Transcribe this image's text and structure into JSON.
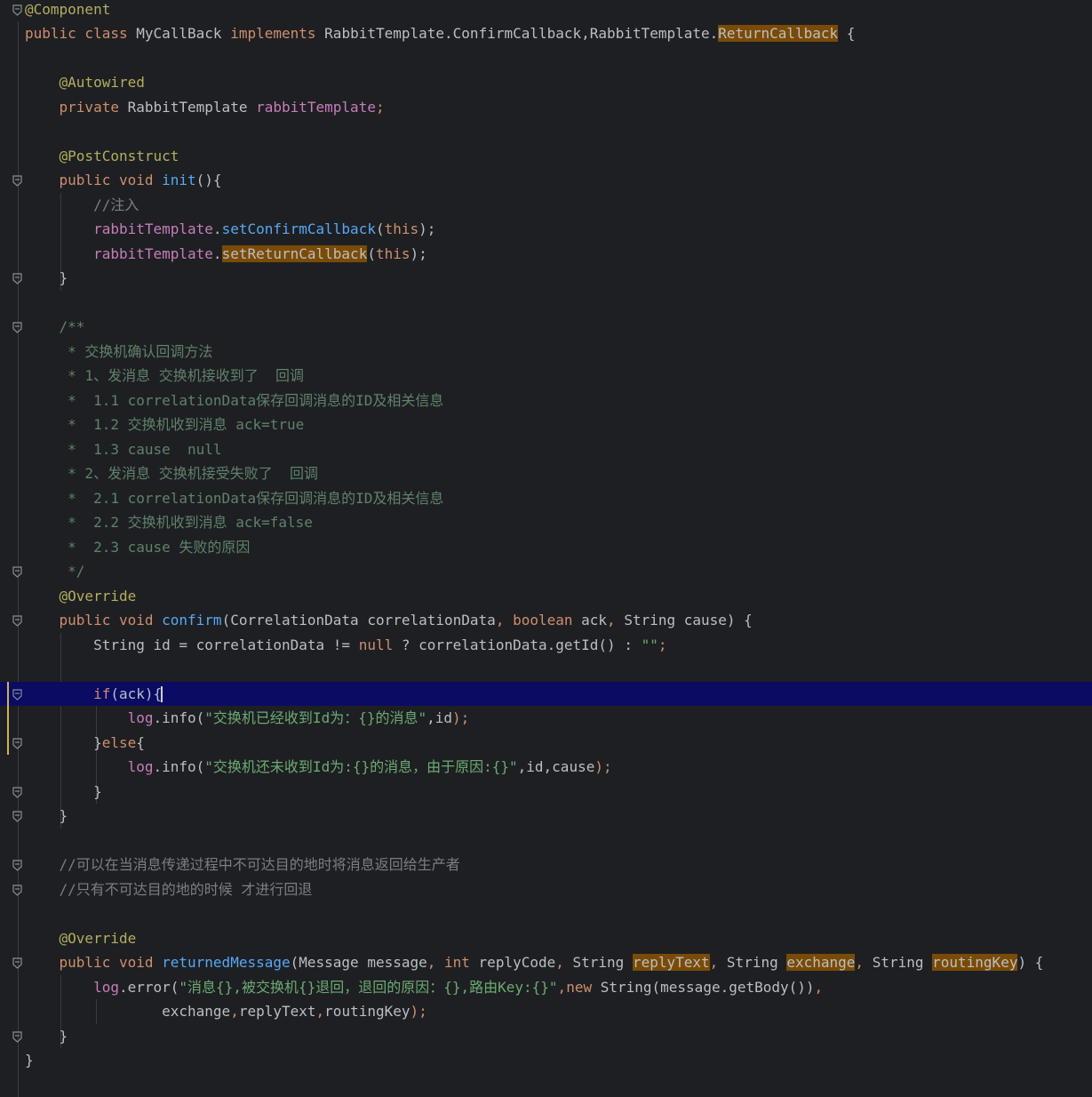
{
  "colors": {
    "background": "#1e1f22",
    "current_line": "#0b0b64",
    "keyword": "#cf8e6d",
    "annotation": "#b3ae60",
    "field": "#c77dbb",
    "method_decl": "#56a8f5",
    "comment": "#7a7e85",
    "doc_comment": "#5f826b",
    "string": "#6aab73",
    "default": "#bcbec4",
    "highlight": "#7a4b06"
  },
  "editor": {
    "lines": [
      {
        "fold": true,
        "tokens": [
          {
            "t": "@Component",
            "c": "annotation"
          }
        ]
      },
      {
        "tokens": [
          {
            "t": "public class ",
            "c": "keyword"
          },
          {
            "t": "MyCallBack ",
            "c": "default"
          },
          {
            "t": "implements ",
            "c": "keyword"
          },
          {
            "t": "RabbitTemplate.ConfirmCallback,RabbitTemplate.",
            "c": "default"
          },
          {
            "t": "ReturnCallback",
            "c": "highlight"
          },
          {
            "t": " {",
            "c": "default"
          }
        ]
      },
      {
        "tokens": []
      },
      {
        "tokens": [
          {
            "t": "    ",
            "c": "default"
          },
          {
            "t": "@Autowired",
            "c": "annotation"
          }
        ]
      },
      {
        "tokens": [
          {
            "t": "    ",
            "c": "default"
          },
          {
            "t": "private ",
            "c": "keyword"
          },
          {
            "t": "RabbitTemplate ",
            "c": "default"
          },
          {
            "t": "rabbitTemplate",
            "c": "field"
          },
          {
            "t": ";",
            "c": "keyword"
          }
        ]
      },
      {
        "tokens": []
      },
      {
        "tokens": [
          {
            "t": "    ",
            "c": "default"
          },
          {
            "t": "@PostConstruct",
            "c": "annotation"
          }
        ]
      },
      {
        "fold": true,
        "tokens": [
          {
            "t": "    ",
            "c": "default"
          },
          {
            "t": "public void ",
            "c": "keyword"
          },
          {
            "t": "init",
            "c": "method_decl"
          },
          {
            "t": "(){",
            "c": "default"
          }
        ]
      },
      {
        "tokens": [
          {
            "t": "        ",
            "c": "default"
          },
          {
            "t": "//注入",
            "c": "comment"
          }
        ]
      },
      {
        "tokens": [
          {
            "t": "        ",
            "c": "default"
          },
          {
            "t": "rabbitTemplate",
            "c": "field"
          },
          {
            "t": ".",
            "c": "default"
          },
          {
            "t": "setConfirmCallback",
            "c": "method_decl"
          },
          {
            "t": "(",
            "c": "default"
          },
          {
            "t": "this",
            "c": "keyword"
          },
          {
            "t": ");",
            "c": "default"
          }
        ]
      },
      {
        "tokens": [
          {
            "t": "        ",
            "c": "default"
          },
          {
            "t": "rabbitTemplate",
            "c": "field"
          },
          {
            "t": ".",
            "c": "default"
          },
          {
            "t": "setReturnCallback",
            "c": "highlight"
          },
          {
            "t": "(",
            "c": "default"
          },
          {
            "t": "this",
            "c": "keyword"
          },
          {
            "t": ");",
            "c": "default"
          }
        ]
      },
      {
        "fold": true,
        "tokens": [
          {
            "t": "    }",
            "c": "default"
          }
        ]
      },
      {
        "tokens": []
      },
      {
        "fold": true,
        "tokens": [
          {
            "t": "    /**",
            "c": "doc_comment"
          }
        ]
      },
      {
        "tokens": [
          {
            "t": "     * 交换机确认回调方法",
            "c": "doc_comment"
          }
        ]
      },
      {
        "tokens": [
          {
            "t": "     * 1、发消息 交换机接收到了  回调",
            "c": "doc_comment"
          }
        ]
      },
      {
        "tokens": [
          {
            "t": "     *  1.1 correlationData保存回调消息的ID及相关信息",
            "c": "doc_comment"
          }
        ]
      },
      {
        "tokens": [
          {
            "t": "     *  1.2 交换机收到消息 ack=true",
            "c": "doc_comment"
          }
        ]
      },
      {
        "tokens": [
          {
            "t": "     *  1.3 cause  null",
            "c": "doc_comment"
          }
        ]
      },
      {
        "tokens": [
          {
            "t": "     * 2、发消息 交换机接受失败了  回调",
            "c": "doc_comment"
          }
        ]
      },
      {
        "tokens": [
          {
            "t": "     *  2.1 correlationData保存回调消息的ID及相关信息",
            "c": "doc_comment"
          }
        ]
      },
      {
        "tokens": [
          {
            "t": "     *  2.2 交换机收到消息 ack=false",
            "c": "doc_comment"
          }
        ]
      },
      {
        "tokens": [
          {
            "t": "     *  2.3 cause 失败的原因",
            "c": "doc_comment"
          }
        ]
      },
      {
        "fold": true,
        "tokens": [
          {
            "t": "     */",
            "c": "doc_comment"
          }
        ]
      },
      {
        "tokens": [
          {
            "t": "    ",
            "c": "default"
          },
          {
            "t": "@Override",
            "c": "annotation"
          }
        ]
      },
      {
        "fold": true,
        "tokens": [
          {
            "t": "    ",
            "c": "default"
          },
          {
            "t": "public void ",
            "c": "keyword"
          },
          {
            "t": "confirm",
            "c": "method_decl"
          },
          {
            "t": "(CorrelationData correlationData",
            "c": "default"
          },
          {
            "t": ", ",
            "c": "keyword"
          },
          {
            "t": "boolean ",
            "c": "keyword"
          },
          {
            "t": "ack",
            "c": "default"
          },
          {
            "t": ", ",
            "c": "keyword"
          },
          {
            "t": "String cause) {",
            "c": "default"
          }
        ]
      },
      {
        "tokens": [
          {
            "t": "        String id = correlationData != ",
            "c": "default"
          },
          {
            "t": "null ",
            "c": "keyword"
          },
          {
            "t": "? correlationData.getId() : ",
            "c": "default"
          },
          {
            "t": "\"\"",
            "c": "string"
          },
          {
            "t": ";",
            "c": "keyword"
          }
        ]
      },
      {
        "tokens": []
      },
      {
        "fold": true,
        "current": true,
        "tokens": [
          {
            "t": "        ",
            "c": "default"
          },
          {
            "t": "if",
            "c": "keyword"
          },
          {
            "t": "(ack){",
            "c": "default"
          }
        ]
      },
      {
        "tokens": [
          {
            "t": "            ",
            "c": "default"
          },
          {
            "t": "log",
            "c": "field"
          },
          {
            "t": ".info(",
            "c": "default"
          },
          {
            "t": "\"交换机已经收到Id为：{}的消息\"",
            "c": "string"
          },
          {
            "t": ",id",
            "c": "default"
          },
          {
            "t": ");",
            "c": "keyword"
          }
        ]
      },
      {
        "fold": true,
        "tokens": [
          {
            "t": "        }",
            "c": "default"
          },
          {
            "t": "else",
            "c": "keyword"
          },
          {
            "t": "{",
            "c": "default"
          }
        ]
      },
      {
        "tokens": [
          {
            "t": "            ",
            "c": "default"
          },
          {
            "t": "log",
            "c": "field"
          },
          {
            "t": ".info(",
            "c": "default"
          },
          {
            "t": "\"交换机还未收到Id为:{}的消息，由于原因:{}\"",
            "c": "string"
          },
          {
            "t": ",id,cause",
            "c": "default"
          },
          {
            "t": ");",
            "c": "keyword"
          }
        ]
      },
      {
        "fold": true,
        "tokens": [
          {
            "t": "        }",
            "c": "default"
          }
        ]
      },
      {
        "fold": true,
        "tokens": [
          {
            "t": "    }",
            "c": "default"
          }
        ]
      },
      {
        "tokens": []
      },
      {
        "fold": true,
        "tokens": [
          {
            "t": "    ",
            "c": "default"
          },
          {
            "t": "//可以在当消息传递过程中不可达目的地时将消息返回给生产者",
            "c": "comment"
          }
        ]
      },
      {
        "fold": true,
        "tokens": [
          {
            "t": "    ",
            "c": "default"
          },
          {
            "t": "//只有不可达目的地的时候 才进行回退",
            "c": "comment"
          }
        ]
      },
      {
        "tokens": []
      },
      {
        "tokens": [
          {
            "t": "    ",
            "c": "default"
          },
          {
            "t": "@Override",
            "c": "annotation"
          }
        ]
      },
      {
        "fold": true,
        "tokens": [
          {
            "t": "    ",
            "c": "default"
          },
          {
            "t": "public void ",
            "c": "keyword"
          },
          {
            "t": "returnedMessage",
            "c": "method_decl"
          },
          {
            "t": "(Message message",
            "c": "default"
          },
          {
            "t": ", ",
            "c": "keyword"
          },
          {
            "t": "int ",
            "c": "keyword"
          },
          {
            "t": "replyCode",
            "c": "default"
          },
          {
            "t": ", ",
            "c": "keyword"
          },
          {
            "t": "String ",
            "c": "default"
          },
          {
            "t": "replyText",
            "c": "highlight"
          },
          {
            "t": ", ",
            "c": "keyword"
          },
          {
            "t": "String ",
            "c": "default"
          },
          {
            "t": "exchange",
            "c": "highlight"
          },
          {
            "t": ", ",
            "c": "keyword"
          },
          {
            "t": "String ",
            "c": "default"
          },
          {
            "t": "routingKey",
            "c": "highlight"
          },
          {
            "t": ") {",
            "c": "default"
          }
        ]
      },
      {
        "tokens": [
          {
            "t": "        ",
            "c": "default"
          },
          {
            "t": "log",
            "c": "field"
          },
          {
            "t": ".error(",
            "c": "default"
          },
          {
            "t": "\"消息{},被交换机{}退回，退回的原因：{},路由Key:{}\"",
            "c": "string"
          },
          {
            "t": ",",
            "c": "keyword"
          },
          {
            "t": "new ",
            "c": "keyword"
          },
          {
            "t": "String(message.getBody())",
            "c": "default"
          },
          {
            "t": ",",
            "c": "keyword"
          }
        ]
      },
      {
        "tokens": [
          {
            "t": "                exchange",
            "c": "default"
          },
          {
            "t": ",",
            "c": "keyword"
          },
          {
            "t": "replyText",
            "c": "default"
          },
          {
            "t": ",",
            "c": "keyword"
          },
          {
            "t": "routingKey",
            "c": "default"
          },
          {
            "t": ");",
            "c": "keyword"
          }
        ]
      },
      {
        "fold": true,
        "tokens": [
          {
            "t": "    }",
            "c": "default"
          }
        ]
      },
      {
        "tokens": [
          {
            "t": "}",
            "c": "default"
          }
        ]
      }
    ]
  }
}
